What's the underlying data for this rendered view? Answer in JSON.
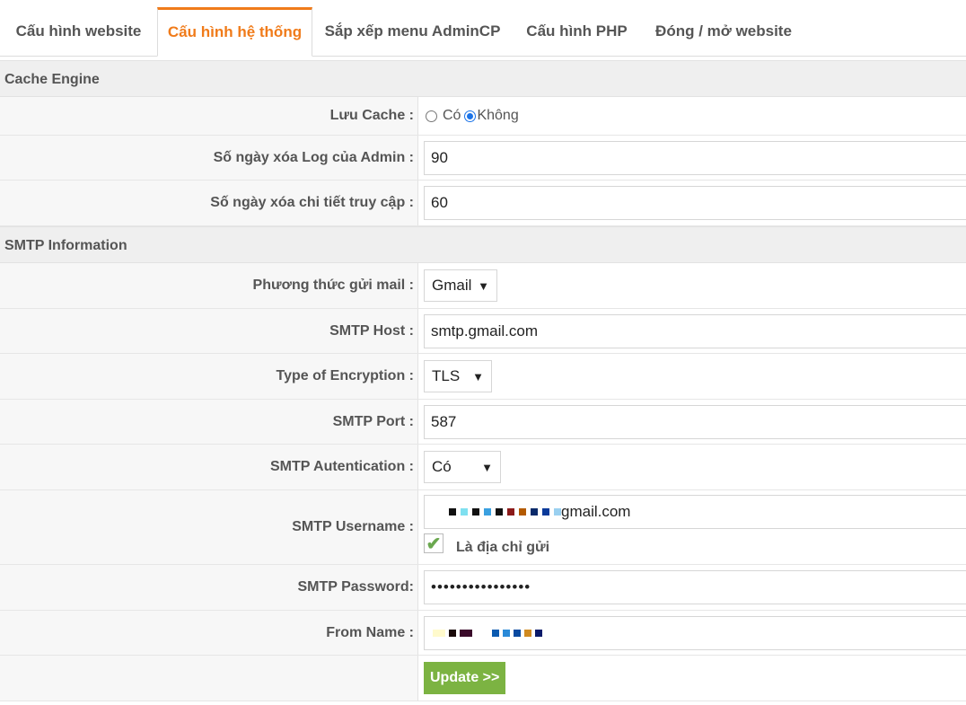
{
  "tabs": [
    {
      "label": "Cấu hình website"
    },
    {
      "label": "Cấu hình hệ thống"
    },
    {
      "label": "Sắp xếp menu AdminCP"
    },
    {
      "label": "Cấu hình PHP"
    },
    {
      "label": "Đóng / mở website"
    }
  ],
  "active_tab": "Cấu hình hệ thống",
  "accent_color": "#f07b1a",
  "sections": {
    "cache": "Cache Engine",
    "smtp": "SMTP Information"
  },
  "cache": {
    "luu_cache_label": "Lưu Cache :",
    "option_yes": "Có",
    "option_no": "Không",
    "selected": "Không",
    "log_days_label": "Số ngày xóa Log của Admin :",
    "log_days_value": "90",
    "access_days_label": "Số ngày xóa chi tiết truy cập :",
    "access_days_value": "60"
  },
  "smtp": {
    "method_label": "Phương thức gửi mail :",
    "method_value": "Gmail",
    "host_label": "SMTP Host :",
    "host_value": "smtp.gmail.com",
    "encryption_label": "Type of Encryption :",
    "encryption_value": "TLS",
    "port_label": "SMTP Port :",
    "port_value": "587",
    "auth_label": "SMTP Autentication :",
    "auth_value": "Có",
    "username_label": "SMTP Username :",
    "username_suffix": "gmail.com",
    "sender_checkbox_label": "Là địa chỉ gửi",
    "password_label": "SMTP Password:",
    "password_value": "••••••••••••••••",
    "from_name_label": "From Name :"
  },
  "update_button": "Update >>",
  "button_color": "#7cb342"
}
